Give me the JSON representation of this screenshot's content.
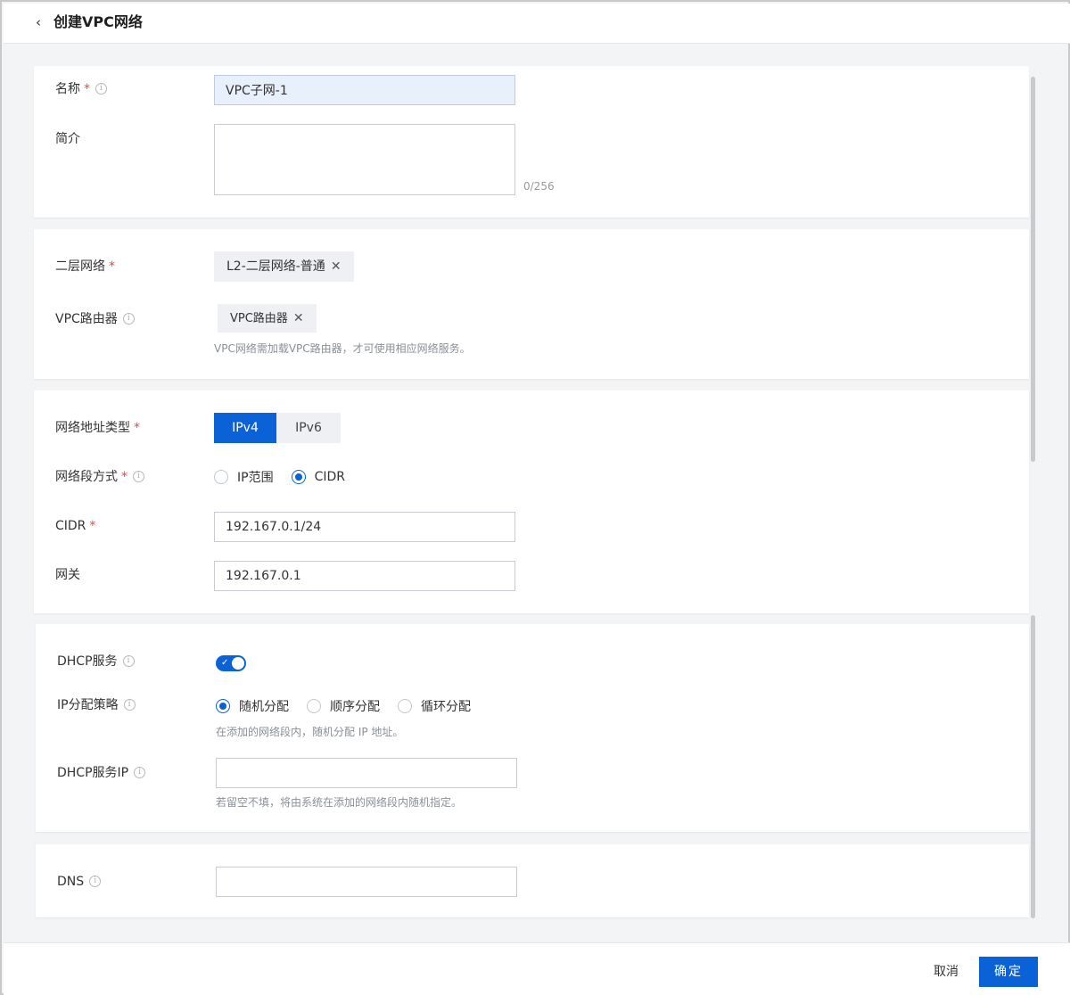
{
  "header": {
    "title": "创建VPC网络"
  },
  "basic": {
    "name_label": "名称",
    "name_value": "VPC子网-1",
    "intro_label": "简介",
    "intro_value": "",
    "intro_counter": "0/256"
  },
  "network": {
    "l2_label": "二层网络",
    "l2_tag": "L2-二层网络-普通",
    "router_label": "VPC路由器",
    "router_tag": "VPC路由器",
    "router_hint": "VPC网络需加载VPC路由器，才可使用相应网络服务。"
  },
  "address": {
    "type_label": "网络地址类型",
    "type_options": [
      "IPv4",
      "IPv6"
    ],
    "type_selected": "IPv4",
    "method_label": "网络段方式",
    "method_options": [
      "IP范围",
      "CIDR"
    ],
    "method_selected": "CIDR",
    "cidr_label": "CIDR",
    "cidr_value": "192.167.0.1/24",
    "gateway_label": "网关",
    "gateway_value": "192.167.0.1"
  },
  "dhcp": {
    "service_label": "DHCP服务",
    "service_enabled": true,
    "strategy_label": "IP分配策略",
    "strategy_options": [
      "随机分配",
      "顺序分配",
      "循环分配"
    ],
    "strategy_selected": "随机分配",
    "strategy_hint": "在添加的网络段内，随机分配 IP 地址。",
    "ip_label": "DHCP服务IP",
    "ip_value": "",
    "ip_hint": "若留空不填，将由系统在添加的网络段内随机指定。"
  },
  "dns": {
    "label": "DNS",
    "value": ""
  },
  "footer": {
    "cancel_label": "取消",
    "ok_label": "确定"
  },
  "colors": {
    "primary": "#0b62d6",
    "required": "#e5484d",
    "page_bg": "#f3f4f6"
  }
}
